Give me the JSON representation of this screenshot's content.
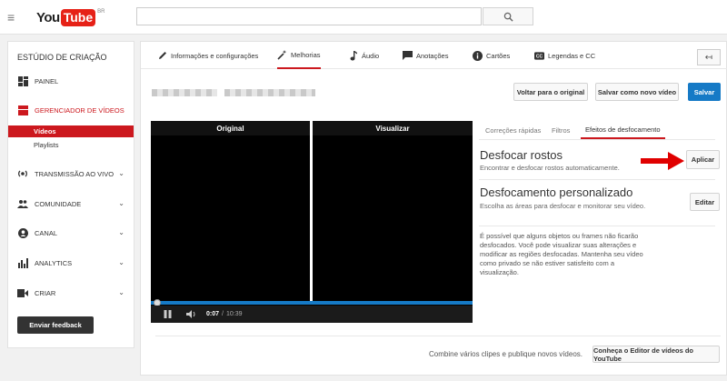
{
  "header": {
    "logo_you": "You",
    "logo_tube": "Tube",
    "logo_country": "BR",
    "search_placeholder": ""
  },
  "sidebar": {
    "title": "ESTÚDIO DE CRIAÇÃO",
    "items": [
      {
        "label": "PAINEL",
        "icon": "dashboard-icon"
      },
      {
        "label": "GERENCIADOR DE VÍDEOS",
        "icon": "video-manager-icon",
        "active": true
      },
      {
        "label": "TRANSMISSÃO AO VIVO",
        "icon": "live-broadcast-icon"
      },
      {
        "label": "COMUNIDADE",
        "icon": "community-icon"
      },
      {
        "label": "CANAL",
        "icon": "channel-icon"
      },
      {
        "label": "ANALYTICS",
        "icon": "analytics-icon"
      },
      {
        "label": "CRIAR",
        "icon": "create-icon"
      }
    ],
    "subitems": [
      {
        "label": "Vídeos",
        "selected": true
      },
      {
        "label": "Playlists"
      }
    ],
    "feedback_label": "Enviar feedback"
  },
  "tabs": [
    {
      "label": "Informações e configurações",
      "icon": "pencil-icon"
    },
    {
      "label": "Melhorias",
      "icon": "magic-wand-icon",
      "active": true
    },
    {
      "label": "Áudio",
      "icon": "music-note-icon"
    },
    {
      "label": "Anotações",
      "icon": "speech-bubble-icon"
    },
    {
      "label": "Cartões",
      "icon": "info-icon"
    },
    {
      "label": "Legendas e CC",
      "icon": "cc-icon"
    }
  ],
  "actions": {
    "revert": "Voltar para o original",
    "save_new": "Salvar como novo vídeo",
    "save": "Salvar"
  },
  "player": {
    "original_label": "Original",
    "preview_label": "Visualizar",
    "time_current": "0:07",
    "time_total": "10:39",
    "progress": 0.02
  },
  "subtabs": [
    {
      "label": "Correções rápidas"
    },
    {
      "label": "Filtros"
    },
    {
      "label": "Efeitos de desfocamento",
      "active": true
    }
  ],
  "features": {
    "blur_faces_title": "Desfocar rostos",
    "blur_faces_desc": "Encontrar e desfocar rostos automaticamente.",
    "apply_label": "Aplicar",
    "custom_blur_title": "Desfocamento personalizado",
    "custom_blur_desc": "Escolha as áreas para desfocar e monitorar seu vídeo.",
    "edit_label": "Editar",
    "note": "É possível que alguns objetos ou frames não ficarão desfocados. Você pode visualizar suas alterações e modificar as regiões desfocadas. Mantenha seu vídeo como privado se não estiver satisfeito com a visualização."
  },
  "footer": {
    "combine_text": "Combine vários clipes e publique novos vídeos.",
    "editor_button": "Conheça o Editor de vídeos do YouTube"
  },
  "colors": {
    "accent_red": "#cc181e",
    "button_blue": "#167ac6",
    "arrow_red": "#e00000"
  }
}
